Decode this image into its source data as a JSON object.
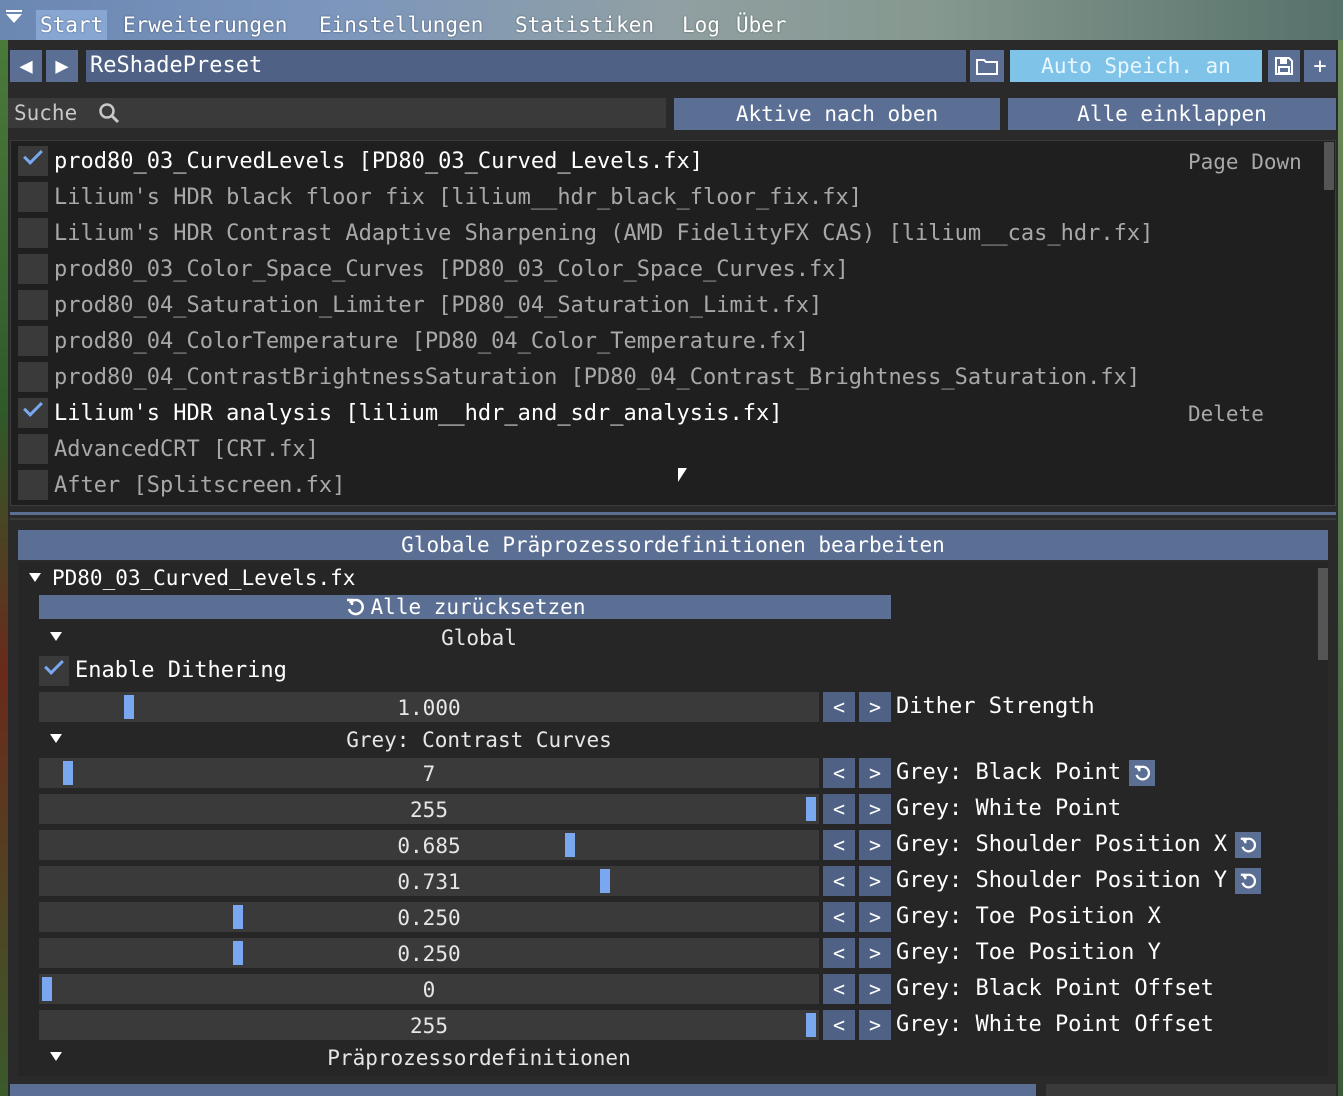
{
  "menu": {
    "items": [
      "Start",
      "Erweiterungen",
      "Einstellungen",
      "Statistiken",
      "Log",
      "Über"
    ],
    "active": "Start"
  },
  "toolbar": {
    "prev_icon": "◀",
    "next_icon": "▶",
    "preset_name": "ReShadePreset",
    "autosave_label": "Auto Speich. an",
    "add_icon": "+"
  },
  "search": {
    "placeholder": "Suche"
  },
  "buttons": {
    "active_to_top": "Aktive nach oben",
    "collapse_all": "Alle einklappen"
  },
  "effects": [
    {
      "label": "prod80_03_CurvedLevels [PD80_03_Curved_Levels.fx]",
      "enabled": true,
      "hint": "Page Down"
    },
    {
      "label": "Lilium's HDR black floor fix [lilium__hdr_black_floor_fix.fx]",
      "enabled": false,
      "hint": ""
    },
    {
      "label": "Lilium's HDR Contrast Adaptive Sharpening (AMD FidelityFX CAS) [lilium__cas_hdr.fx]",
      "enabled": false,
      "hint": ""
    },
    {
      "label": "prod80_03_Color_Space_Curves [PD80_03_Color_Space_Curves.fx]",
      "enabled": false,
      "hint": ""
    },
    {
      "label": "prod80_04_Saturation_Limiter [PD80_04_Saturation_Limit.fx]",
      "enabled": false,
      "hint": ""
    },
    {
      "label": "prod80_04_ColorTemperature [PD80_04_Color_Temperature.fx]",
      "enabled": false,
      "hint": ""
    },
    {
      "label": "prod80_04_ContrastBrightnessSaturation [PD80_04_Contrast_Brightness_Saturation.fx]",
      "enabled": false,
      "hint": ""
    },
    {
      "label": "Lilium's HDR analysis [lilium__hdr_and_sdr_analysis.fx]",
      "enabled": true,
      "hint": "Delete"
    },
    {
      "label": "AdvancedCRT [CRT.fx]",
      "enabled": false,
      "hint": ""
    },
    {
      "label": "After [Splitscreen.fx]",
      "enabled": false,
      "hint": ""
    }
  ],
  "params": {
    "global_button": "Globale Präprozessordefinitionen bearbeiten",
    "fx_file": "PD80_03_Curved_Levels.fx",
    "reset_all": "Alle zurücksetzen",
    "section_global": "Global",
    "enable_dithering": "Enable Dithering",
    "section_grey": "Grey: Contrast Curves",
    "section_preproc": "Präprozessordefinitionen",
    "arrow_left": "<",
    "arrow_right": ">",
    "sliders": [
      {
        "value_text": "1.000",
        "label": "Dither Strength",
        "fraction": 0.107,
        "has_reset": false
      },
      {
        "value_text": "7",
        "label": "Grey: Black Point",
        "fraction": 0.027,
        "has_reset": true
      },
      {
        "value_text": "255",
        "label": "Grey: White Point",
        "fraction": 1.0,
        "has_reset": false
      },
      {
        "value_text": "0.685",
        "label": "Grey: Shoulder Position X",
        "fraction": 0.685,
        "has_reset": true
      },
      {
        "value_text": "0.731",
        "label": "Grey: Shoulder Position Y",
        "fraction": 0.731,
        "has_reset": true
      },
      {
        "value_text": "0.250",
        "label": "Grey: Toe Position X",
        "fraction": 0.25,
        "has_reset": false
      },
      {
        "value_text": "0.250",
        "label": "Grey: Toe Position Y",
        "fraction": 0.25,
        "has_reset": false
      },
      {
        "value_text": "0",
        "label": "Grey: Black Point Offset",
        "fraction": 0.0,
        "has_reset": false
      },
      {
        "value_text": "255",
        "label": "Grey: White Point Offset",
        "fraction": 1.0,
        "has_reset": false
      }
    ]
  },
  "colors": {
    "accent": "#5a6f93",
    "grab": "#7aa8f0",
    "autosave": "#7fc4e8"
  }
}
